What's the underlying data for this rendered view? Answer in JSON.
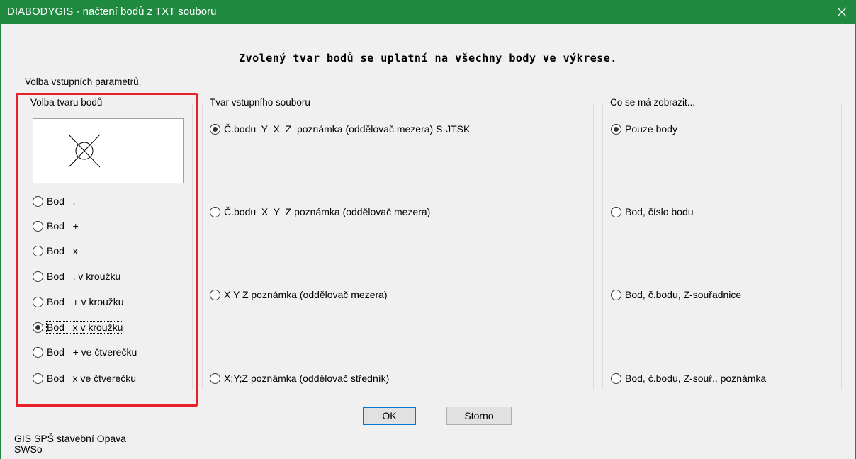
{
  "window": {
    "title": "DIABODYGIS - načtení bodů z TXT souboru",
    "close_icon": "close-icon",
    "accent": "#1f8a3f"
  },
  "headline": "Zvolený tvar bodů se uplatní na všechny body ve výkrese.",
  "outer_group": {
    "label": "Volba vstupních parametrů."
  },
  "shape_group": {
    "label": "Volba tvaru bodů",
    "preview_icon": "x-in-circle-icon",
    "options": [
      {
        "label": "Bod   .",
        "checked": false
      },
      {
        "label": "Bod   +",
        "checked": false
      },
      {
        "label": "Bod   x",
        "checked": false
      },
      {
        "label": "Bod   . v kroužku",
        "checked": false
      },
      {
        "label": "Bod   + v kroužku",
        "checked": false
      },
      {
        "label": "Bod   x v kroužku",
        "checked": true
      },
      {
        "label": "Bod   + ve čtverečku",
        "checked": false
      },
      {
        "label": "Bod   x ve čtverečku",
        "checked": false
      }
    ],
    "highlight_color": "#e8202a"
  },
  "file_group": {
    "label": "Tvar vstupního souboru",
    "options": [
      {
        "label": "Č.bodu  Y  X  Z  poznámka (oddělovač mezera) S-JTSK",
        "checked": true
      },
      {
        "label": "Č.bodu  X  Y  Z poznámka (oddělovač mezera)",
        "checked": false
      },
      {
        "label": "X Y Z poznámka (oddělovač mezera)",
        "checked": false
      },
      {
        "label": "X;Y;Z poznámka (oddělovač středník)",
        "checked": false
      }
    ]
  },
  "show_group": {
    "label": "Co se má zobrazit...",
    "options": [
      {
        "label": "Pouze body",
        "checked": true
      },
      {
        "label": "Bod, číslo bodu",
        "checked": false
      },
      {
        "label": "Bod, č.bodu, Z-souřadnice",
        "checked": false
      },
      {
        "label": "Bod, č.bodu, Z-souř., poznámka",
        "checked": false
      }
    ]
  },
  "buttons": {
    "ok": "OK",
    "cancel": "Storno"
  },
  "footer": {
    "line1": "GIS SPŠ stavební Opava",
    "line2": "SWSo"
  }
}
